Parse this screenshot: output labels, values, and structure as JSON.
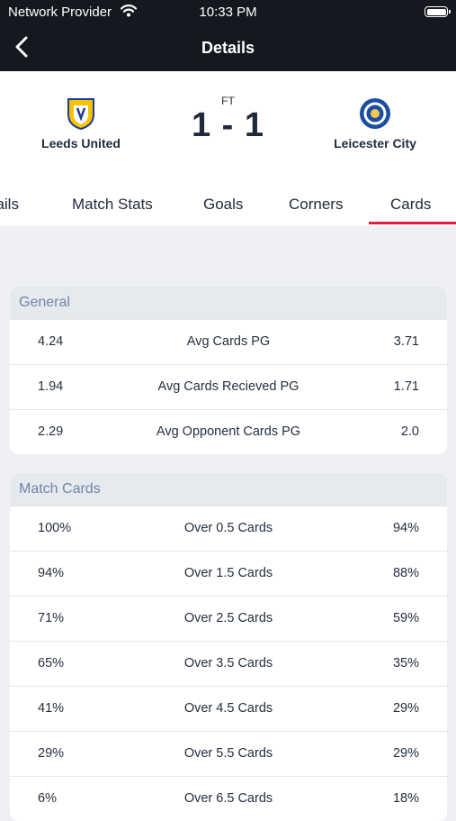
{
  "status_bar": {
    "provider": "Network Provider",
    "time": "10:33 PM"
  },
  "nav": {
    "title": "Details"
  },
  "match": {
    "status": "FT",
    "score": "1 - 1",
    "home": {
      "name": "Leeds United",
      "color": "#f5c400"
    },
    "away": {
      "name": "Leicester City",
      "color": "#1c4da1"
    }
  },
  "tabs": [
    "Details",
    "Match Stats",
    "Goals",
    "Corners",
    "Cards"
  ],
  "active_tab": "Cards",
  "accent_color": "#e11d48",
  "general": {
    "title": "General",
    "rows": [
      {
        "home": "4.24",
        "label": "Avg Cards PG",
        "away": "3.71"
      },
      {
        "home": "1.94",
        "label": "Avg Cards Recieved PG",
        "away": "1.71"
      },
      {
        "home": "2.29",
        "label": "Avg Opponent Cards PG",
        "away": "2.0"
      }
    ]
  },
  "match_cards": {
    "title": "Match Cards",
    "rows": [
      {
        "home": "100%",
        "label": "Over 0.5 Cards",
        "away": "94%"
      },
      {
        "home": "94%",
        "label": "Over 1.5 Cards",
        "away": "88%"
      },
      {
        "home": "71%",
        "label": "Over 2.5 Cards",
        "away": "59%"
      },
      {
        "home": "65%",
        "label": "Over 3.5 Cards",
        "away": "35%"
      },
      {
        "home": "41%",
        "label": "Over 4.5 Cards",
        "away": "29%"
      },
      {
        "home": "29%",
        "label": "Over 5.5 Cards",
        "away": "29%"
      },
      {
        "home": "6%",
        "label": "Over 6.5 Cards",
        "away": "18%"
      }
    ]
  }
}
